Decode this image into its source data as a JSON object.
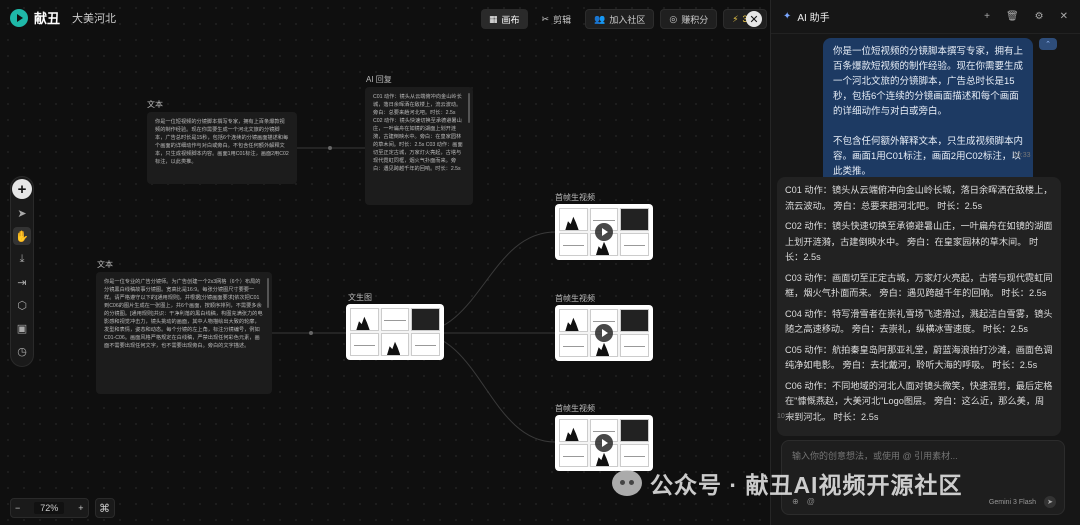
{
  "app": {
    "brand": "献丑",
    "project": "大美河北"
  },
  "topnav": [
    {
      "id": "canvas",
      "icon": "grid-icon",
      "glyph": "▦",
      "label": "画布",
      "active": true
    },
    {
      "id": "edit",
      "icon": "scissors-icon",
      "glyph": "✂",
      "label": "剪辑",
      "active": false
    },
    {
      "id": "community",
      "icon": "users-icon",
      "glyph": "👥",
      "label": "加入社区",
      "active": false
    },
    {
      "id": "earn",
      "icon": "coin-icon",
      "glyph": "◎",
      "label": "赚积分",
      "active": false
    },
    {
      "id": "energy",
      "icon": "lightning-icon",
      "glyph": "⚡",
      "label": "326",
      "active": false
    }
  ],
  "canvas": {
    "text_node_1": {
      "label": "文本",
      "content": "你是一位短视频的分镜脚本撰写专家，拥有上百条爆款视频的制作经验。现在你需要生成一个河北文旅的分镜脚本，广告总时长是15秒，包括6个连续的分镜画面描述和每个画面的详细动作与对白或旁白。不包含任何额外解释文本，只生成视频脚本内容。画面1用C01标注，画面2用C02标注，以此类推。"
    },
    "ai_reply_node": {
      "label": "AI 回复",
      "content": "C01 动作：镜头从云端俯冲向金山岭长城，落日余晖洒在敌楼上，流云波动。旁白：总要来趟河北吧。时长：2.5s C02 动作：镜头快速切换至承德避暑山庄，一叶扁舟在如镜的湖面上划开涟漪，古建倒映水中。旁白：在皇家园林的草木间。时长：2.5s C03 动作：画面切至正定古城，万家灯火亮起，古塔与现代霓虹同框，烟火气扑面而来。旁白：遇见跨越千年的回响。时长：2.5s"
    },
    "text_node_2": {
      "label": "文本",
      "content": "你是一位专业的广告分镜师。为广告创建一个2x3网格（6个）布局的分镜黑白线稿故事分镜图。宽高比是16:9。每张分镜图尺寸要要一样。请严格遵守以下的[通用规则]，并根据[分镜画面要求]依次把C01到C06的图片生成在一张图上，共6个画面，按顺序排列，不需要多余的分镜图。[通用规则]共识：干净利落的黑白线稿，构图充满张力的电影感和视觉冲击力，镜头挑动的画面，其中人物描绘出大致的轮廓，发型和表情，姿态和动态。每个分镜的左上角，标注分镜编号，例如C01-C06。画面风格严格规定在白线稿，严禁出现任何彩色元素，画面不需要出现任何文字，也不需要出现旁白。旁白的文字描述。"
    },
    "storyboard_node": {
      "label": "文生图"
    },
    "video_nodes": [
      {
        "label": "首帧生视频"
      },
      {
        "label": "首帧生视频"
      },
      {
        "label": "首帧生视频"
      }
    ]
  },
  "zoom": {
    "minus": "−",
    "value": "72%",
    "plus": "+",
    "cmd": "⌘"
  },
  "panel": {
    "title": "AI 助手",
    "user_message": {
      "paragraph1": "你是一位短视频的分镜脚本撰写专家，拥有上百条爆款短视频的制作经验。现在你需要生成一个河北文旅的分镜脚本，广告总时长是15秒，包括6个连续的分镜画面描述和每个画面的详细动作与对白或旁白。",
      "paragraph2": "不包含任何额外解释文本，只生成视频脚本内容。画面1用C01标注，画面2用C02标注，以此类推。",
      "time": "10:33"
    },
    "ai_message": {
      "lines": [
        "C01 动作：镜头从云端俯冲向金山岭长城，落日余晖洒在敌楼上，流云波动。 旁白：总要来趟河北吧。 时长：2.5s",
        "C02 动作：镜头快速切换至承德避暑山庄，一叶扁舟在如镜的湖面上划开涟漪，古建倒映水中。 旁白：在皇家园林的草木间。 时长：2.5s",
        "C03 动作：画面切至正定古城，万家灯火亮起，古塔与现代霓虹同框，烟火气扑面而来。 旁白：遇见跨越千年的回响。 时长：2.5s",
        "C04 动作：特写滑雪者在崇礼雪场飞速滑过，溅起洁白雪雾，镜头随之高速移动。 旁白：去崇礼，纵横冰雪速度。 时长：2.5s",
        "C05 动作：航拍秦皇岛阿那亚礼堂，蔚蓝海浪拍打沙滩，画面色调纯净如电影。 旁白：去北戴河，聆听大海的呼吸。 时长：2.5s",
        "C06 动作：不同地域的河北人面对镜头微笑，快速混剪，最后定格在\"慷慨燕赵，大美河北\"Logo图层。 旁白：这么近，那么美，周末到河北。 时长：2.5s"
      ],
      "time": "10:33"
    },
    "input": {
      "placeholder": "输入你的创意想法，或使用 @ 引用素材...",
      "model": "Gemini 3 Flash"
    }
  },
  "watermark": {
    "text": "公众号 · 献丑AI视频开源社区"
  }
}
